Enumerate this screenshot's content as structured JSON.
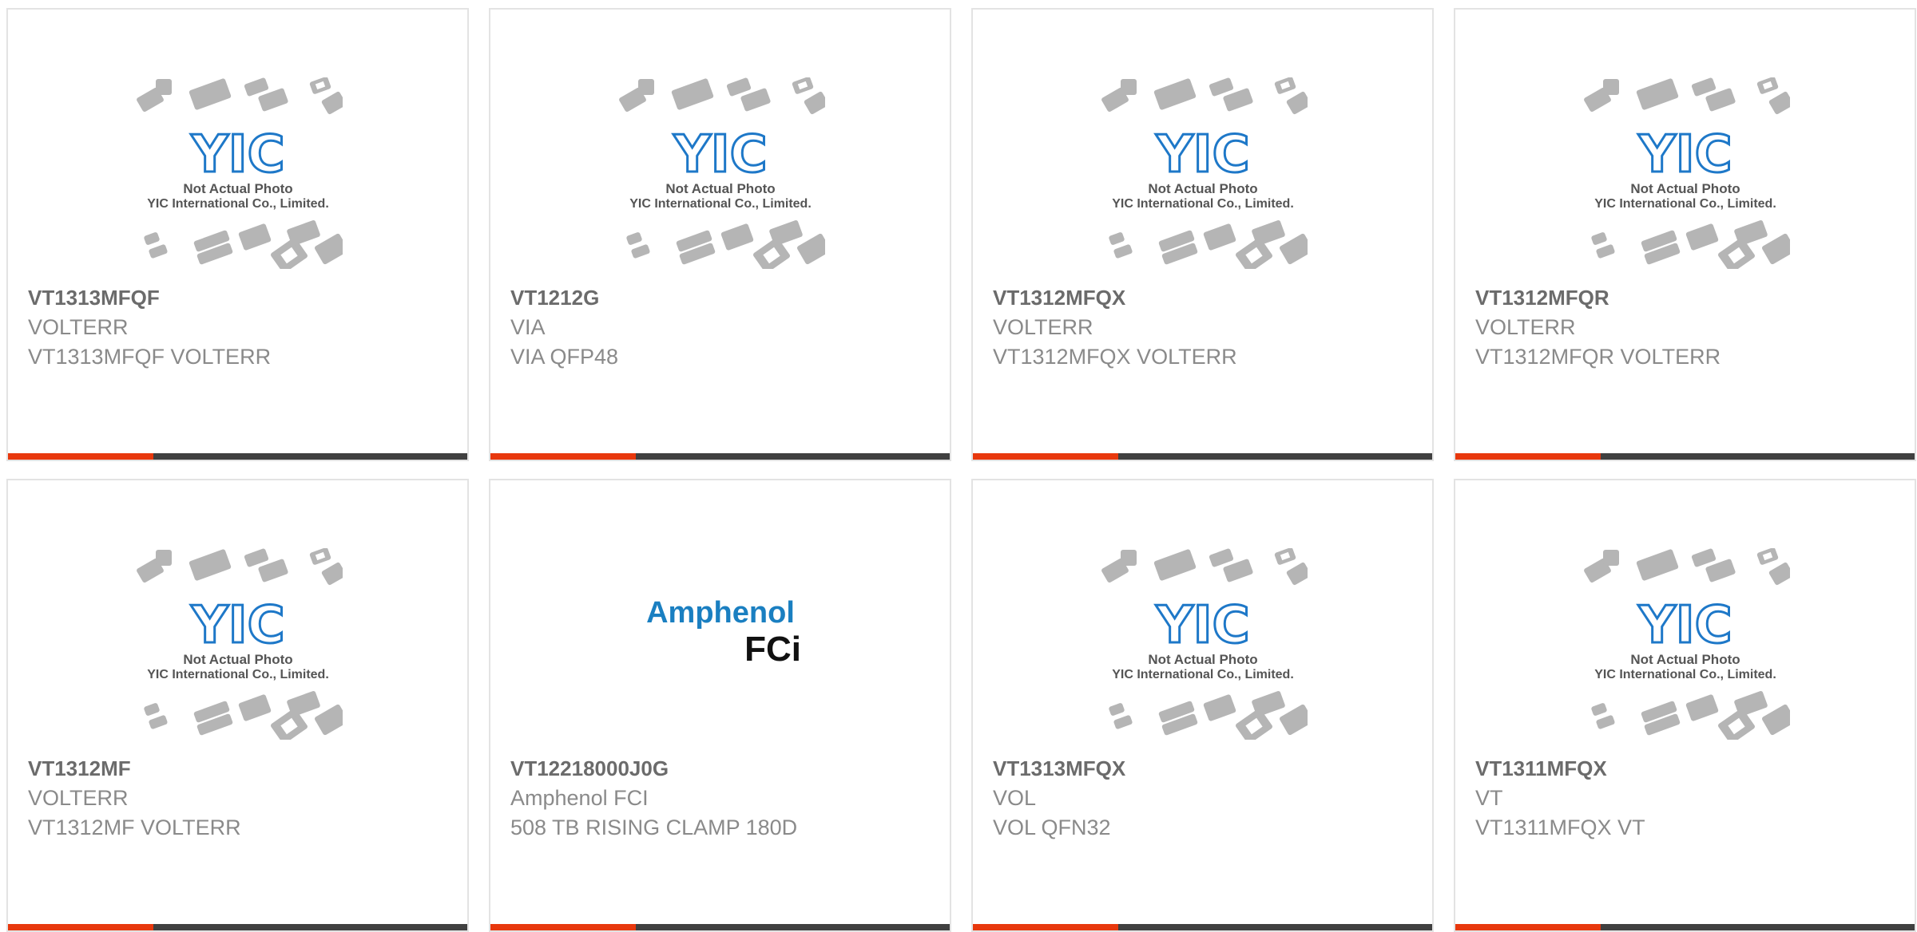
{
  "products": [
    {
      "part_number": "VT1313MFQF",
      "brand": "VOLTERR",
      "description": "VT1313MFQF VOLTERR",
      "image": {
        "type": "placeholder",
        "line1": "Not Actual Photo",
        "line2": "YIC International Co., Limited.",
        "logo_text": "YIC"
      }
    },
    {
      "part_number": "VT1212G",
      "brand": "VIA",
      "description": "VIA QFP48",
      "image": {
        "type": "placeholder",
        "line1": "Not Actual Photo",
        "line2": "YIC International Co., Limited.",
        "logo_text": "YIC"
      }
    },
    {
      "part_number": "VT1312MFQX",
      "brand": "VOLTERR",
      "description": "VT1312MFQX VOLTERR",
      "image": {
        "type": "placeholder",
        "line1": "Not Actual Photo",
        "line2": "YIC International Co., Limited.",
        "logo_text": "YIC"
      }
    },
    {
      "part_number": "VT1312MFQR",
      "brand": "VOLTERR",
      "description": "VT1312MFQR VOLTERR",
      "image": {
        "type": "placeholder",
        "line1": "Not Actual Photo",
        "line2": "YIC International Co., Limited.",
        "logo_text": "YIC"
      }
    },
    {
      "part_number": "VT1312MF",
      "brand": "VOLTERR",
      "description": "VT1312MF VOLTERR",
      "image": {
        "type": "placeholder",
        "line1": "Not Actual Photo",
        "line2": "YIC International Co., Limited.",
        "logo_text": "YIC"
      }
    },
    {
      "part_number": "VT12218000J0G",
      "brand": "Amphenol FCI",
      "description": "508 TB RISING CLAMP 180D",
      "image": {
        "type": "brand-logo",
        "logo_line1": "Amphenol",
        "logo_line2": "FCi"
      }
    },
    {
      "part_number": "VT1313MFQX",
      "brand": "VOL",
      "description": "VOL QFN32",
      "image": {
        "type": "placeholder",
        "line1": "Not Actual Photo",
        "line2": "YIC International Co., Limited.",
        "logo_text": "YIC"
      }
    },
    {
      "part_number": "VT1311MFQX",
      "brand": "VT",
      "description": "VT1311MFQX VT",
      "image": {
        "type": "placeholder",
        "line1": "Not Actual Photo",
        "line2": "YIC International Co., Limited.",
        "logo_text": "YIC"
      }
    }
  ],
  "colors": {
    "accent": "#e8380d",
    "bar": "#404040",
    "yic_blue": "#1e78c8",
    "amphenol_blue": "#1a7fc1",
    "chip_gray": "#b5b5b5"
  }
}
